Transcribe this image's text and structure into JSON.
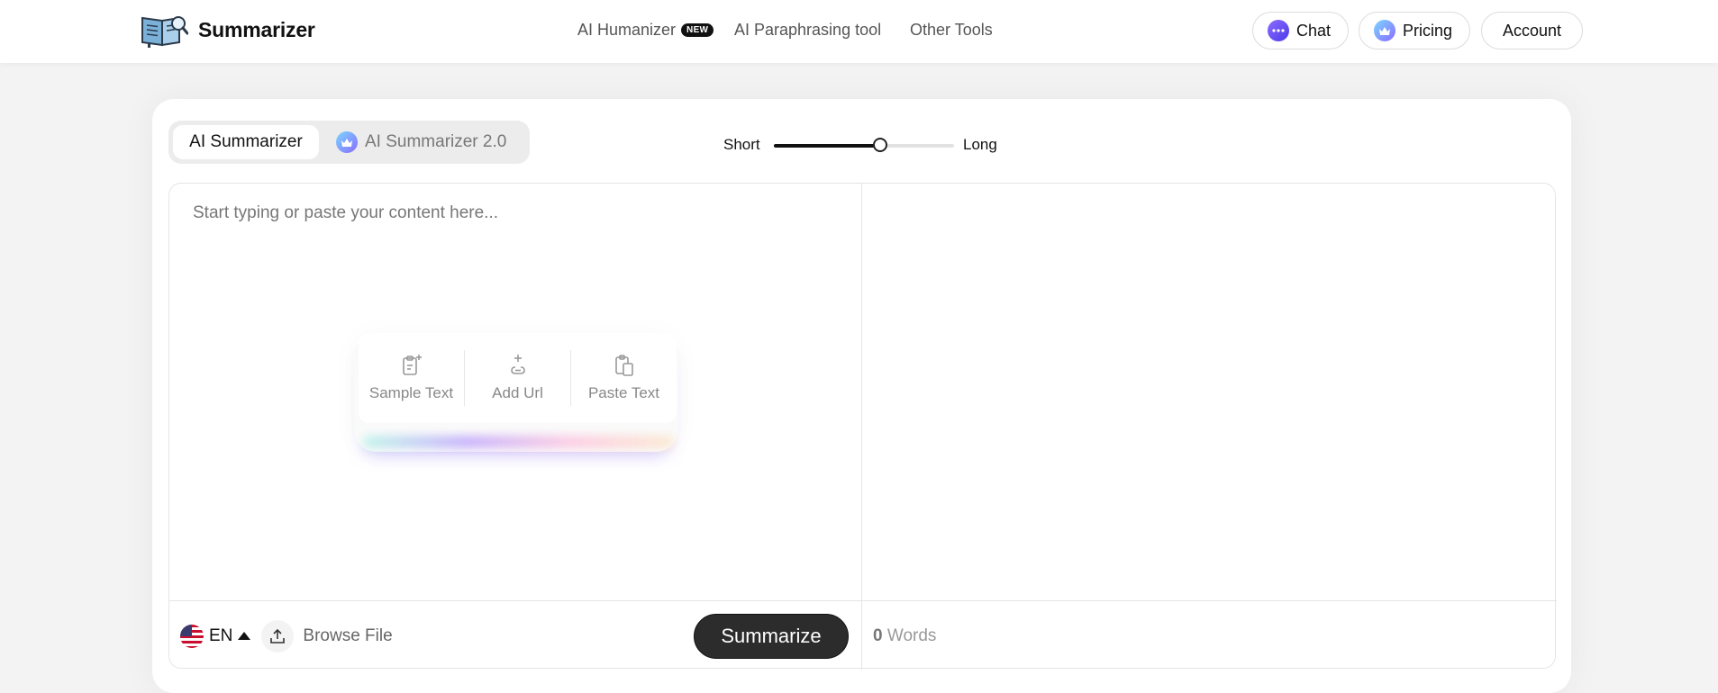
{
  "header": {
    "brand": "Summarizer",
    "nav": {
      "humanizer": "AI Humanizer",
      "humanizer_badge": "NEW",
      "paraphrasing": "AI Paraphrasing tool",
      "other_tools": "Other Tools"
    },
    "buttons": {
      "chat": "Chat",
      "pricing": "Pricing",
      "account": "Account"
    }
  },
  "tool": {
    "tabs": {
      "active": "AI Summarizer",
      "second": "AI Summarizer 2.0"
    },
    "length": {
      "short_label": "Short",
      "long_label": "Long",
      "value_fraction": 0.59
    },
    "input": {
      "placeholder": "Start typing or paste your content here...",
      "value": ""
    },
    "quick_actions": {
      "sample": "Sample Text",
      "url": "Add Url",
      "paste": "Paste Text"
    },
    "language": "EN",
    "browse_label": "Browse File",
    "summarize_label": "Summarize",
    "word_count": "0",
    "word_label": "Words"
  },
  "colors": {
    "primary_button": "#2c2c2c",
    "chat_icon": "#6a4cf5",
    "pricing_icon": "#8a6cff"
  }
}
